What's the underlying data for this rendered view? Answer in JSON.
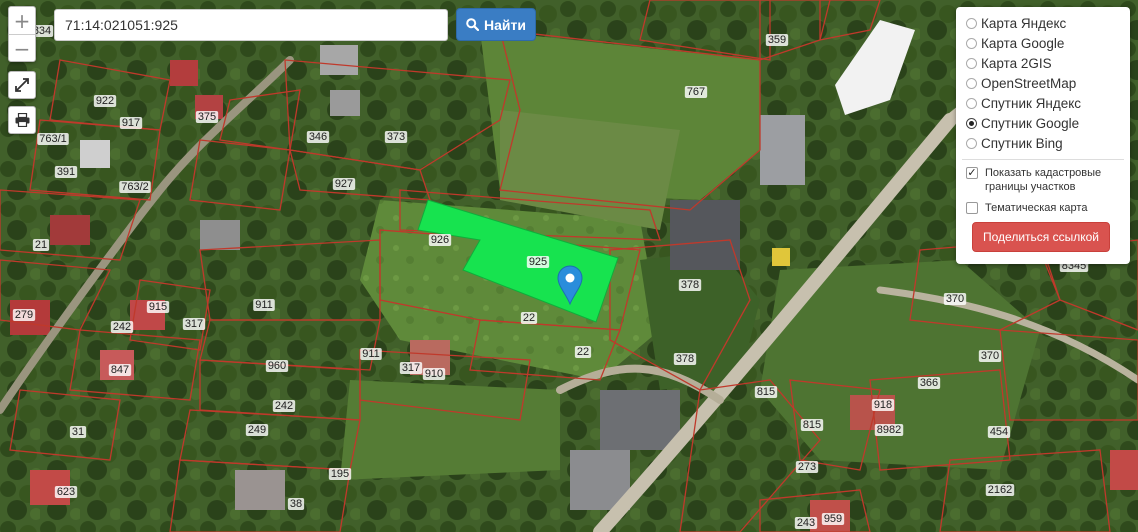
{
  "search": {
    "value": "71:14:021051:925",
    "button_label": "Найти",
    "search_icon": "search-icon"
  },
  "controls": {
    "zoom_in": "+",
    "zoom_out": "−",
    "fullscreen_icon": "expand-icon",
    "print_icon": "printer-icon"
  },
  "layers": {
    "items": [
      {
        "label": "Карта Яндекс",
        "checked": false
      },
      {
        "label": "Карта Google",
        "checked": false
      },
      {
        "label": "Карта 2GIS",
        "checked": false
      },
      {
        "label": "OpenStreetMap",
        "checked": false
      },
      {
        "label": "Спутник Яндекс",
        "checked": false
      },
      {
        "label": "Спутник Google",
        "checked": true
      },
      {
        "label": "Спутник Bing",
        "checked": false
      }
    ],
    "show_cadastral": {
      "label": "Показать кадастровые границы участков",
      "checked": true
    },
    "thematic": {
      "label": "Тематическая карта",
      "checked": false
    },
    "share_label": "Поделиться ссылкой"
  },
  "map": {
    "selected_parcel": "925",
    "parcel_labels": [
      "834",
      "922",
      "917",
      "375",
      "763/1",
      "391",
      "763/2",
      "346",
      "373",
      "927",
      "767",
      "359",
      "926",
      "21",
      "911",
      "242",
      "915",
      "317",
      "279",
      "847",
      "911",
      "317",
      "910",
      "960",
      "242",
      "249",
      "31",
      "195",
      "38",
      "623",
      "378",
      "378",
      "22",
      "22",
      "815",
      "815",
      "273",
      "243",
      "959",
      "370",
      "370",
      "366",
      "918",
      "8982",
      "454",
      "2162",
      "8345"
    ],
    "colors": {
      "parcel_line": "#c0392b",
      "selected_fill": "#17e34f",
      "marker": "#2a8ddb"
    }
  }
}
